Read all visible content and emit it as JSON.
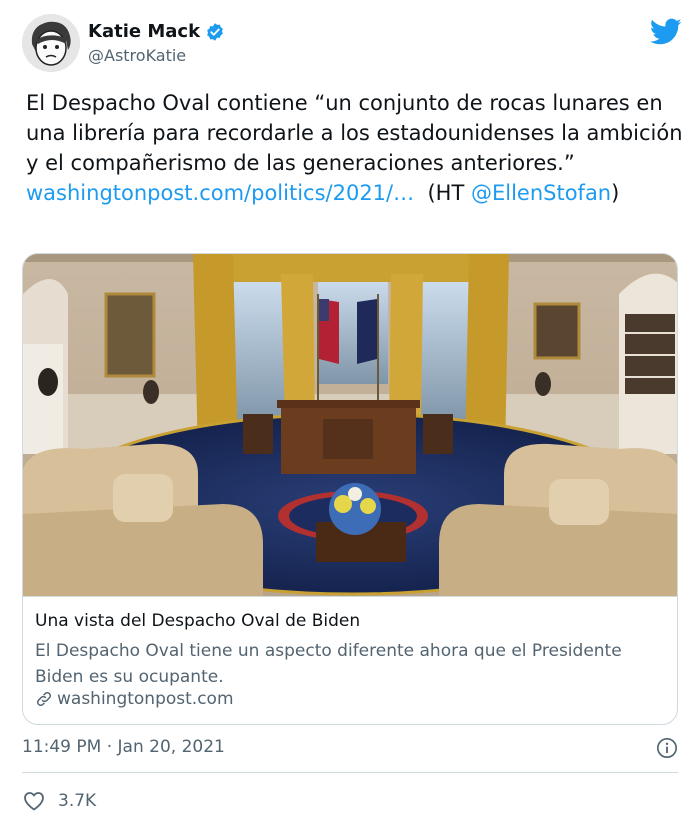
{
  "author": {
    "name": "Katie Mack",
    "handle": "@AstroKatie"
  },
  "tweet": {
    "text": "El Despacho Oval contiene “un conjunto de rocas lunares  en una librería para recordarle a los estadounidenses la ambición y el compañerismo de las generaciones anteriores.” ",
    "link_text": "washingtonpost.com/politics/2021/…",
    "ht_prefix": "  (HT ",
    "mention": "@EllenStofan",
    "ht_suffix": ")"
  },
  "card": {
    "title": "Una vista del Despacho Oval de Biden",
    "description": "El Despacho Oval tiene un aspecto diferente ahora que el Presidente Biden es su ocupante.",
    "domain": "washingtonpost.com"
  },
  "meta": {
    "time": "11:49 PM",
    "separator": " · ",
    "date": "Jan 20, 2021"
  },
  "engagement": {
    "likes": "3.7K"
  },
  "colors": {
    "accent": "#1d9bf0",
    "secondary_text": "#536471",
    "border": "#cfd9de"
  },
  "icons": [
    "verified-badge-icon",
    "twitter-bird-icon",
    "link-icon",
    "info-icon",
    "heart-icon"
  ]
}
